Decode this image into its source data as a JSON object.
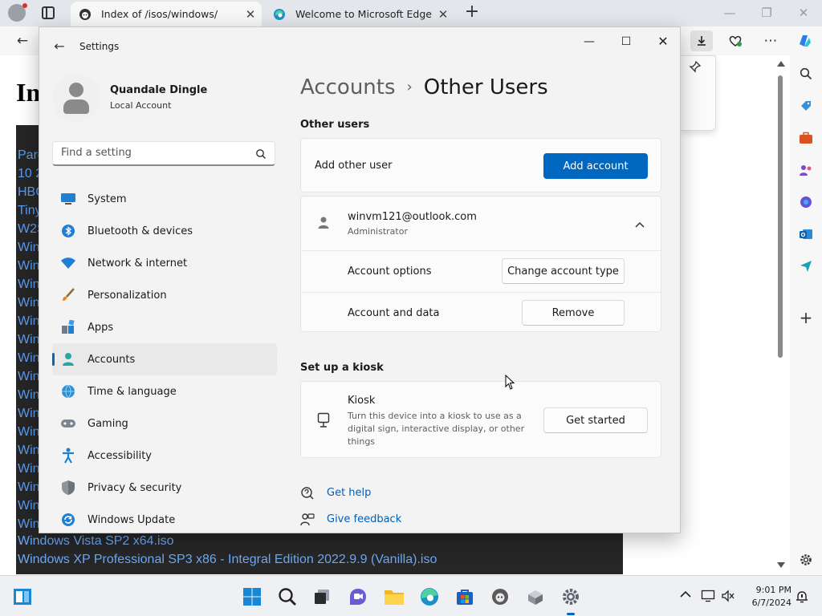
{
  "browser": {
    "tabs": [
      {
        "title": "Index of /isos/windows/"
      },
      {
        "title": "Welcome to Microsoft Edge"
      }
    ],
    "page_heading": "In",
    "directory_items_partial": [
      "Pare",
      "10 2",
      "HBC",
      "Tiny",
      "W2S",
      "Win",
      "Win",
      "Win",
      "Win",
      "Win",
      "Win",
      "Win",
      "Win",
      "Win",
      "Win",
      "Win",
      "Win",
      "Win",
      "Win",
      "Win",
      "Win"
    ],
    "directory_items_full": [
      "Windows Vista SP2 x64.iso",
      "Windows XP Professional SP3 x86 - Integral Edition 2022.9.9 (Vanilla).iso"
    ]
  },
  "settings": {
    "app_title": "Settings",
    "user": {
      "name": "Quandale Dingle",
      "account_type": "Local Account"
    },
    "search_placeholder": "Find a setting",
    "nav": [
      {
        "label": "System",
        "icon": "monitor-icon"
      },
      {
        "label": "Bluetooth & devices",
        "icon": "bluetooth-icon"
      },
      {
        "label": "Network & internet",
        "icon": "wifi-icon"
      },
      {
        "label": "Personalization",
        "icon": "brush-icon"
      },
      {
        "label": "Apps",
        "icon": "apps-icon"
      },
      {
        "label": "Accounts",
        "icon": "person-icon",
        "selected": true
      },
      {
        "label": "Time & language",
        "icon": "globe-clock-icon"
      },
      {
        "label": "Gaming",
        "icon": "gamepad-icon"
      },
      {
        "label": "Accessibility",
        "icon": "accessibility-icon"
      },
      {
        "label": "Privacy & security",
        "icon": "shield-icon"
      },
      {
        "label": "Windows Update",
        "icon": "update-icon"
      }
    ],
    "breadcrumb": {
      "parent": "Accounts",
      "separator": "›",
      "current": "Other Users"
    },
    "other_users": {
      "section_title": "Other users",
      "add_label": "Add other user",
      "add_button": "Add account",
      "user_email": "winvm121@outlook.com",
      "user_role": "Administrator",
      "options_label": "Account options",
      "change_type_button": "Change account type",
      "data_label": "Account and data",
      "remove_button": "Remove"
    },
    "kiosk": {
      "section_title": "Set up a kiosk",
      "title": "Kiosk",
      "description": [
        "Turn this device into a kiosk to use as a",
        "digital sign, interactive display, or other",
        "things"
      ],
      "button": "Get started"
    },
    "links": {
      "help": "Get help",
      "feedback": "Give feedback"
    }
  },
  "taskbar": {
    "time": "9:01 PM",
    "date": "6/7/2024"
  },
  "colors": {
    "accent": "#0067c0",
    "link": "#005fb8",
    "directory_bg": "#262626",
    "directory_link": "#5b9cf0"
  }
}
